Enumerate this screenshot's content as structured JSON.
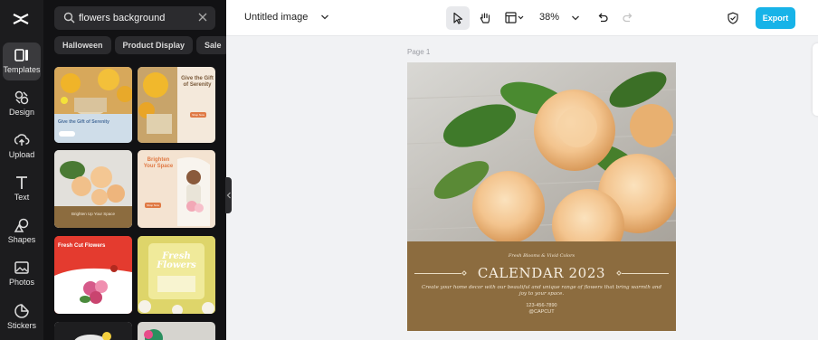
{
  "rail": {
    "items": [
      {
        "label": "Templates",
        "icon": "templates-icon"
      },
      {
        "label": "Design",
        "icon": "design-icon"
      },
      {
        "label": "Upload",
        "icon": "upload-icon"
      },
      {
        "label": "Text",
        "icon": "text-icon"
      },
      {
        "label": "Shapes",
        "icon": "shapes-icon"
      },
      {
        "label": "Photos",
        "icon": "photos-icon"
      },
      {
        "label": "Stickers",
        "icon": "stickers-icon"
      }
    ],
    "active": "Templates"
  },
  "search": {
    "value": "flowers background"
  },
  "chips": [
    "Halloween",
    "Product Display",
    "Sale"
  ],
  "thumbnails": {
    "serenity_left": {
      "title": "Give the Gift of Serenity"
    },
    "serenity_right": {
      "title": "Give the Gift of Serenity",
      "button": "Shop Now"
    },
    "roses": {
      "caption": "Brighten Up Your Space"
    },
    "brighten": {
      "title": "Brighten Your Space",
      "button": "Shop Now"
    },
    "fresh_cut": {
      "title": "Fresh Cut Flowers"
    },
    "fresh_flowers": {
      "title": "Fresh Flowers"
    }
  },
  "topbar": {
    "doc_title": "Untitled image",
    "zoom": "38%",
    "export_label": "Export"
  },
  "canvas": {
    "page_label": "Page 1",
    "script_text": "Fresh Blooms & Vivid Colors",
    "title": "CALENDAR 2023",
    "description": "Create your home decor with our beautiful and unique range of flowers that bring warmth and joy to your space.",
    "phone": "123-456-7890",
    "handle": "@CAPCUT"
  },
  "colors": {
    "accent": "#17b3e8",
    "rail_bg": "#1c1c1e",
    "panel_bg": "#121214",
    "band": "#8c6c3f"
  }
}
